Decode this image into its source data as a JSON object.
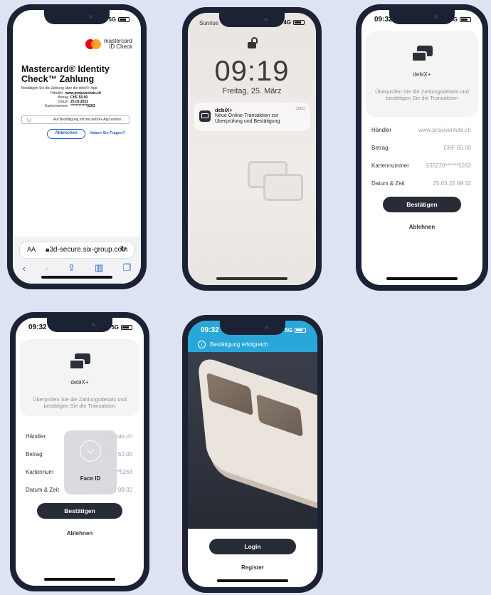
{
  "phone1": {
    "brand": {
      "line1": "mastercard",
      "line2": "ID Check"
    },
    "title": "Mastercard® Identity Check™ Zahlung",
    "description": "Bestätigen Sie die Zahlung über die debiX+ App.",
    "details": [
      {
        "key": "Händler",
        "value": "www.projuventute.ch"
      },
      {
        "key": "Betrag",
        "value": "CHF 50.00"
      },
      {
        "key": "Datum",
        "value": "25.03.2022"
      },
      {
        "key": "Kartennummer",
        "value": "************5263"
      }
    ],
    "waiting": "Auf Bestätigung mit der debiX+ App warten ...",
    "cancel_label": "Abbrechen",
    "help_label": "Haben Sie Fragen?",
    "url": "3d-secure.six-group.com",
    "aa": "AA",
    "network": "5G"
  },
  "phone2": {
    "carrier": "Sunrise",
    "network": "4G",
    "time": "09:19",
    "date": "Freitag, 25. März",
    "notification": {
      "app": "debiX+",
      "message": "Neue Online-Transaktion zur Überprüfung und Bestätigung",
      "when": "Jetzt"
    }
  },
  "phone3": {
    "time": "09:32",
    "network": "5G",
    "app_name": "debiX+",
    "prompt": "Überprüfen Sie die Zahlungsdetails und bestätigen Sie die Transaktion",
    "rows": [
      {
        "key": "Händler",
        "value": "www.projuventute.ch"
      },
      {
        "key": "Betrag",
        "value": "CHF 50.00"
      },
      {
        "key": "Kartennummer",
        "value": "535220******5263"
      },
      {
        "key": "Datum & Zeit",
        "value": "25.03.22 09:32"
      }
    ],
    "confirm_label": "Bestätigen",
    "decline_label": "Ablehnen"
  },
  "phone4": {
    "time": "09:32",
    "network": "5G",
    "app_name": "debiX+",
    "prompt": "Überprüfen Sie die Zahlungsdetails und bestätigen Sie die Transaktion",
    "rows": [
      {
        "key": "Händler",
        "value": "ventute.ch"
      },
      {
        "key": "Betrag",
        "value": "CHF 50.00"
      },
      {
        "key": "Kartennum",
        "value": "*****5263"
      },
      {
        "key": "Datum & Zeit",
        "value": "25.03.22 09:32"
      }
    ],
    "face_id_label": "Face ID",
    "confirm_label": "Bestätigen",
    "decline_label": "Ablehnen"
  },
  "phone5": {
    "time": "09:32",
    "network": "5G",
    "success_text": "Bestätigung erfolgreich",
    "info_glyph": "i",
    "login_label": "Login",
    "register_label": "Register"
  }
}
